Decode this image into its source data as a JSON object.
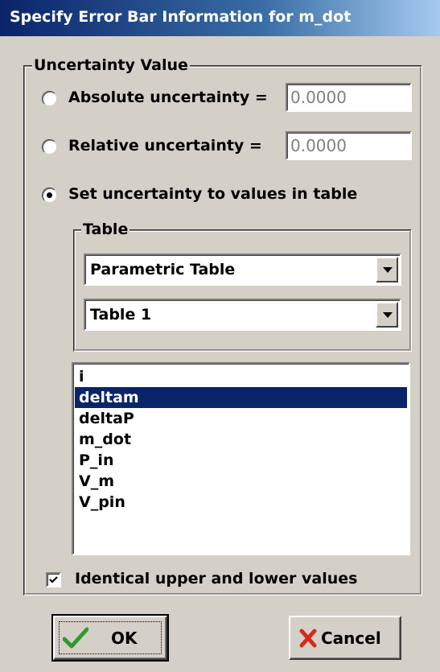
{
  "window": {
    "title": "Specify Error Bar Information for m_dot"
  },
  "uncertainty_group": {
    "legend": "Uncertainty Value",
    "options": [
      {
        "label": "Absolute uncertainty =",
        "value": "0.0000",
        "selected": false
      },
      {
        "label": "Relative uncertainty =",
        "value": "0.0000",
        "selected": false
      },
      {
        "label": "Set uncertainty to values in table",
        "selected": true
      }
    ]
  },
  "table_group": {
    "legend": "Table",
    "table_type": "Parametric Table",
    "table_name": "Table 1"
  },
  "column_list": {
    "items": [
      "i",
      "deltam",
      "deltaP",
      "m_dot",
      "P_in",
      "V_m",
      "V_pin"
    ],
    "selected": "deltam"
  },
  "identical_checkbox": {
    "label": "Identical upper and lower values",
    "checked": true
  },
  "buttons": {
    "ok": "OK",
    "cancel": "Cancel"
  },
  "colors": {
    "title_bar": "#0a246a",
    "selection": "#0a246a",
    "ok_check": "#2e9b2e",
    "cancel_x": "#d42a1c"
  },
  "icons": {
    "ok": "checkmark-icon",
    "cancel": "x-icon"
  }
}
